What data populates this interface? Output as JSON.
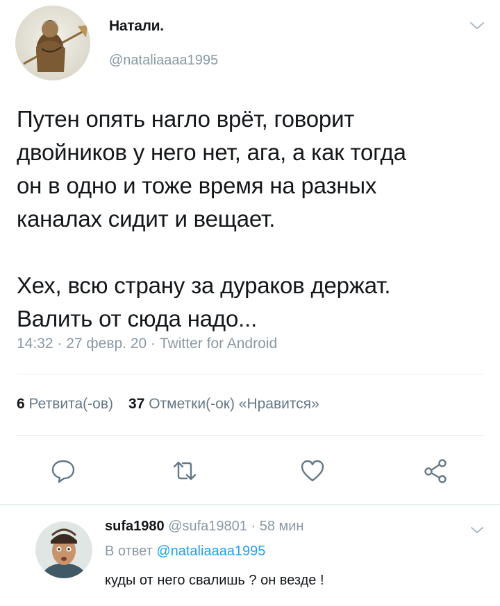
{
  "tweet": {
    "author": {
      "display_name": "Натали.",
      "handle": "@nataliaaaa1995"
    },
    "text": "Путен опять нагло врёт, говорит\nдвойников у него нет, ага, а как тогда\nон в одно и тоже время на разных\nканалах сидит и вещает.\n\nХех, всю страну за дураков держат.\nВалить от сюда надо...",
    "meta": "14:32 · 27 февр. 20 · Twitter for Android",
    "stats": {
      "retweets_count": "6",
      "retweets_label": "Ретвита(-ов)",
      "likes_count": "37",
      "likes_label": "Отметки(-ок) «Нравится»"
    }
  },
  "reply": {
    "author_name": "sufa1980",
    "author_handle": "@sufa19801",
    "time": "· 58 мин",
    "in_reply_to_prefix": "В ответ",
    "in_reply_to_handle": "@nataliaaaa1995",
    "text": "куды от него свалишь ? он везде !"
  },
  "icons": {
    "actions": [
      "reply-icon",
      "retweet-icon",
      "like-icon",
      "share-icon"
    ],
    "menu": "chevron-down-icon"
  },
  "colors": {
    "text": "#14171a",
    "secondary": "#8899a6",
    "link": "#1da1f2",
    "divider": "#e1e8ed",
    "icon": "#657786"
  }
}
